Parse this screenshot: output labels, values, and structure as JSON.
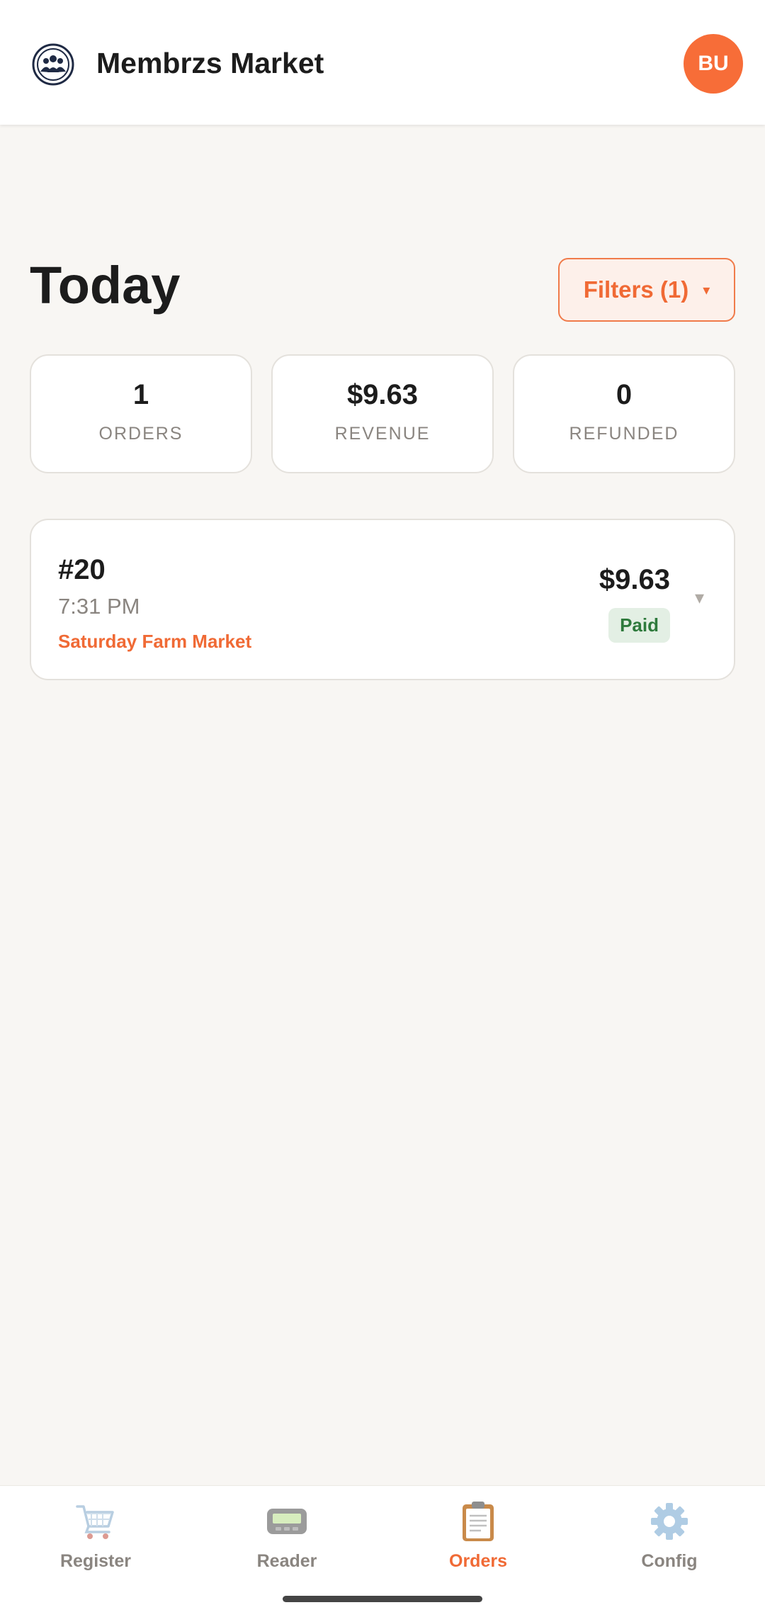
{
  "header": {
    "brand_name": "Membrzs Market",
    "logo_icon": "members-group-icon",
    "avatar_initials": "BU",
    "accent_color": "#f76d38"
  },
  "page": {
    "title": "Today",
    "filters_label": "Filters (1)",
    "filters_caret": "▾"
  },
  "stats": [
    {
      "value": "1",
      "label": "ORDERS"
    },
    {
      "value": "$9.63",
      "label": "REVENUE"
    },
    {
      "value": "0",
      "label": "REFUNDED"
    }
  ],
  "orders": [
    {
      "number": "#20",
      "time": "7:31 PM",
      "location": "Saturday Farm Market",
      "amount": "$9.63",
      "status": "Paid",
      "status_color": "#2e7a3c",
      "caret": "▾"
    }
  ],
  "bottom_nav": [
    {
      "label": "Register",
      "icon": "shopping-cart-icon",
      "active": false
    },
    {
      "label": "Reader",
      "icon": "card-reader-icon",
      "active": false
    },
    {
      "label": "Orders",
      "icon": "clipboard-icon",
      "active": true
    },
    {
      "label": "Config",
      "icon": "gear-icon",
      "active": false
    }
  ]
}
